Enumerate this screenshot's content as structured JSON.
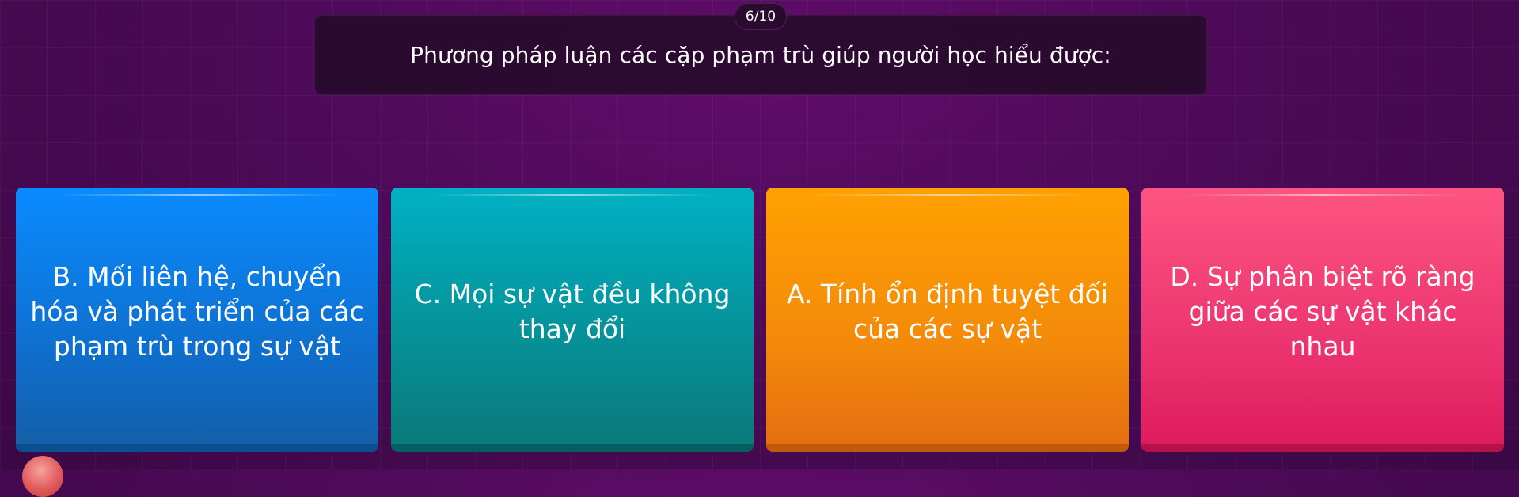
{
  "quiz": {
    "progress": "6/10",
    "question": "Phương pháp luận các cặp phạm trù giúp người học hiểu được:",
    "answers": [
      {
        "label": "B. Mối liên hệ, chuyển hóa và phát triển của các phạm trù trong sự vật",
        "color": "#0a8bff"
      },
      {
        "label": "C. Mọi sự vật đều không thay đổi",
        "color": "#00b1c3"
      },
      {
        "label": "A. Tính ổn định tuyệt đối của các sự vật",
        "color": "#ffa102"
      },
      {
        "label": "D. Sự phân biệt rõ ràng giữa các sự vật khác nhau",
        "color": "#fd5482"
      }
    ]
  }
}
